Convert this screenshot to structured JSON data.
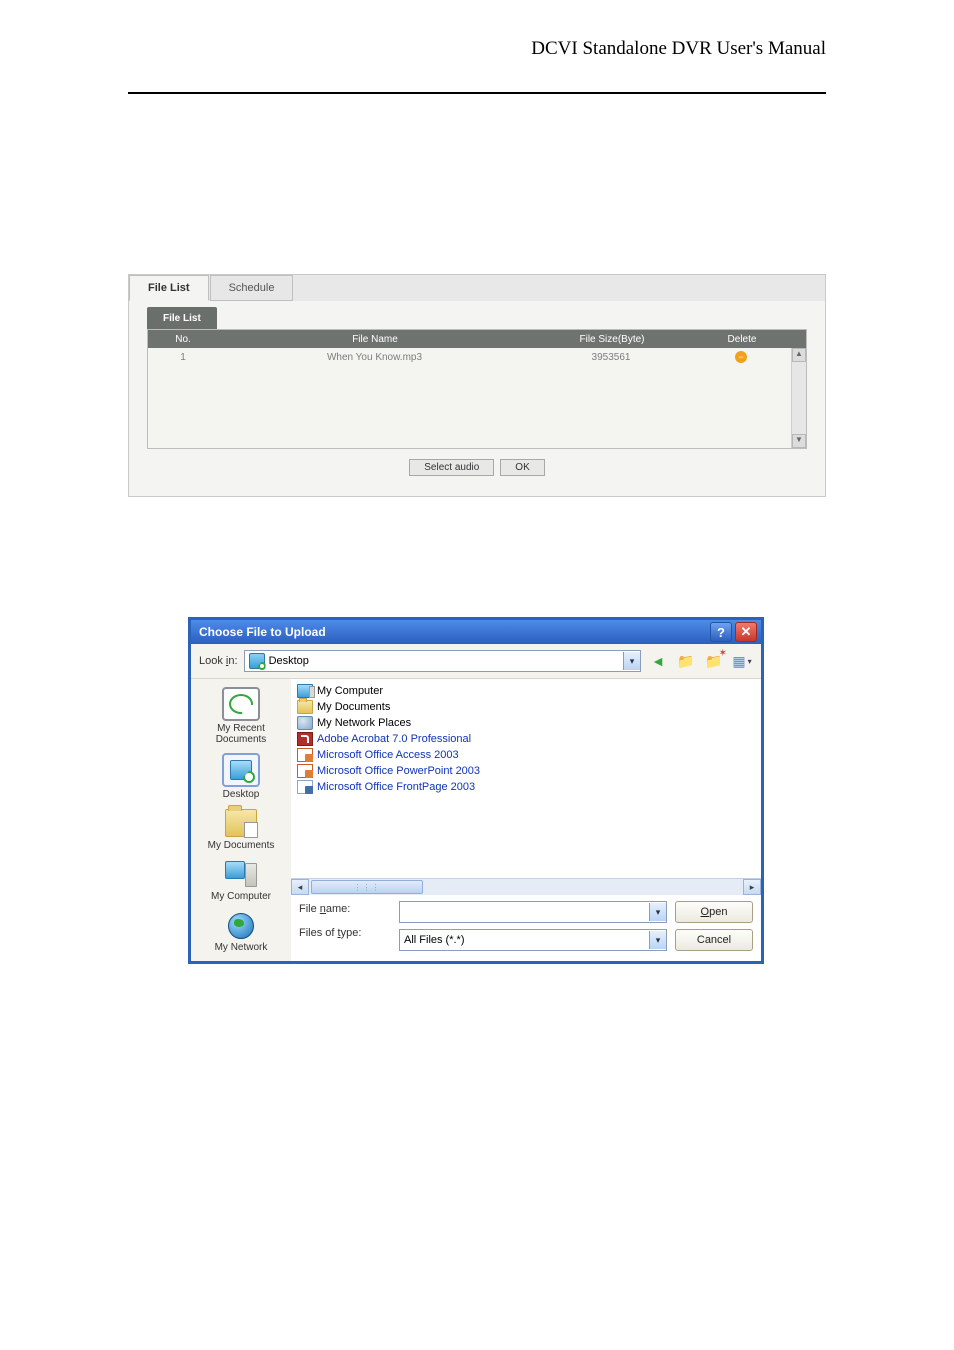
{
  "header": {
    "title": "DCVI Standalone DVR User's Manual"
  },
  "fig1": {
    "tabs": {
      "fileList": "File List",
      "schedule": "Schedule"
    },
    "subTab": "File List",
    "columns": {
      "no": "No.",
      "name": "File Name",
      "size": "File Size(Byte)",
      "del": "Delete"
    },
    "rows": [
      {
        "no": "1",
        "name": "When You Know.mp3",
        "size": "3953561"
      }
    ],
    "buttons": {
      "select": "Select audio",
      "ok": "OK"
    }
  },
  "fig2": {
    "title": "Choose File to Upload",
    "lookInLabel": "Look in:",
    "lookInValue": "Desktop",
    "places": {
      "recent": "My Recent Documents",
      "desktop": "Desktop",
      "mydocs": "My Documents",
      "mycomp": "My Computer",
      "network": "My Network"
    },
    "list": {
      "myComputer": "My Computer",
      "myDocuments": "My Documents",
      "myNetworkPlaces": "My Network Places",
      "acrobat": "Adobe Acrobat 7.0 Professional",
      "access": "Microsoft Office Access 2003",
      "ppt": "Microsoft Office PowerPoint 2003",
      "frontpage": "Microsoft Office FrontPage 2003"
    },
    "fileNameLabel": "File name:",
    "fileTypeLabel": "Files of type:",
    "fileNameValue": "",
    "fileTypeValue": "All Files (*.*)",
    "buttons": {
      "open": "Open",
      "cancel": "Cancel"
    }
  }
}
